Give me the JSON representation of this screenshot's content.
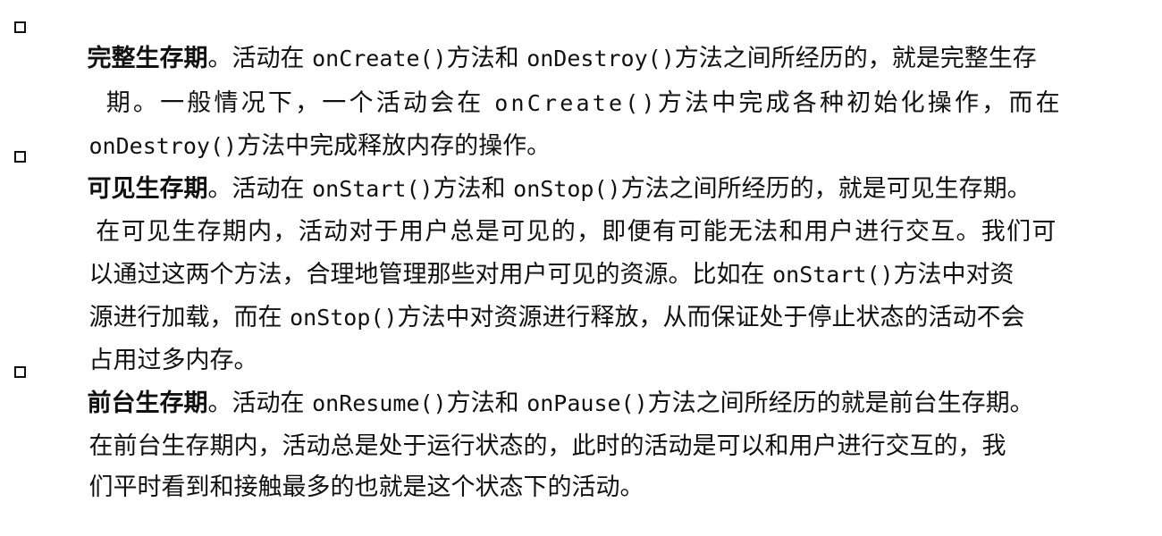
{
  "items": [
    {
      "term": "完整生存期",
      "lines": [
        [
          {
            "t": "。活动在 "
          },
          {
            "t": "onCreate()",
            "code": true
          },
          {
            "t": "方法和 "
          },
          {
            "t": "onDestroy()",
            "code": true
          },
          {
            "t": "方法之间所经历的，就是完整生存"
          }
        ],
        [
          {
            "t": "期。一般情况下，一个活动会在 "
          },
          {
            "t": "onCreate()",
            "code": true
          },
          {
            "t": "方法中完成各种初始化操作，而在"
          }
        ],
        [
          {
            "t": "onDestroy()",
            "code": true
          },
          {
            "t": "方法中完成释放内存的操作。"
          }
        ]
      ]
    },
    {
      "term": "可见生存期",
      "lines": [
        [
          {
            "t": "。活动在 "
          },
          {
            "t": "onStart()",
            "code": true
          },
          {
            "t": "方法和 "
          },
          {
            "t": "onStop()",
            "code": true
          },
          {
            "t": "方法之间所经历的，就是可见生存期。"
          }
        ],
        [
          {
            "t": "在可见生存期内，活动对于用户总是可见的，即便有可能无法和用户进行交互。我们可"
          }
        ],
        [
          {
            "t": "以通过这两个方法，合理地管理那些对用户可见的资源。比如在 "
          },
          {
            "t": "onStart()",
            "code": true
          },
          {
            "t": "方法中对资"
          }
        ],
        [
          {
            "t": "源进行加载，而在 "
          },
          {
            "t": "onStop()",
            "code": true
          },
          {
            "t": "方法中对资源进行释放，从而保证处于停止状态的活动不会"
          }
        ],
        [
          {
            "t": "占用过多内存。"
          }
        ]
      ]
    },
    {
      "term": "前台生存期",
      "lines": [
        [
          {
            "t": "。活动在 "
          },
          {
            "t": "onResume()",
            "code": true
          },
          {
            "t": "方法和 "
          },
          {
            "t": "onPause()",
            "code": true
          },
          {
            "t": "方法之间所经历的就是前台生存期。"
          }
        ],
        [
          {
            "t": "在前台生存期内，活动总是处于运行状态的，此时的活动是可以和用户进行交互的，我"
          }
        ],
        [
          {
            "t": "们平时看到和接触最多的也就是这个状态下的活动。"
          }
        ]
      ]
    }
  ]
}
